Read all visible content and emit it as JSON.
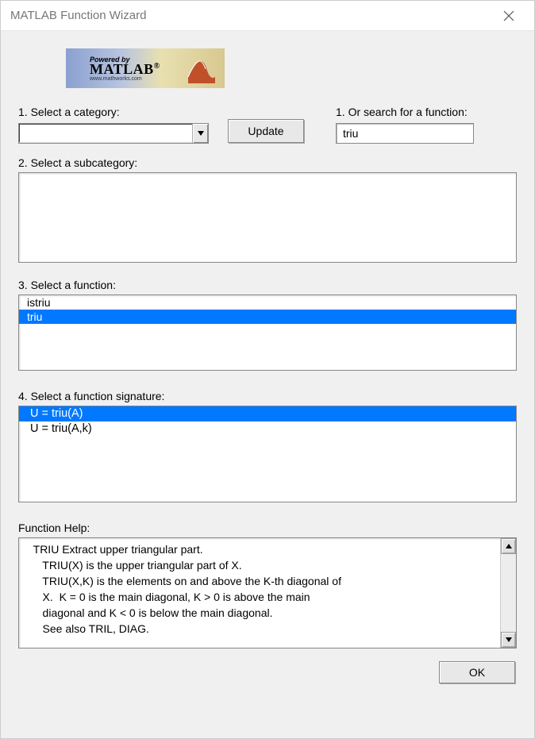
{
  "window": {
    "title": "MATLAB Function Wizard"
  },
  "logo": {
    "powered": "Powered by",
    "brand": "MATLAB",
    "url": "www.mathworks.com"
  },
  "labels": {
    "category": "1. Select a category:",
    "search": "1. Or search for a function:",
    "update": "Update",
    "subcategory": "2. Select a subcategory:",
    "function": "3. Select a function:",
    "signature": "4. Select a function signature:",
    "help": "Function Help:",
    "ok": "OK"
  },
  "category": {
    "value": ""
  },
  "search": {
    "value": "triu"
  },
  "functions": [
    {
      "name": "istriu",
      "selected": false
    },
    {
      "name": "triu",
      "selected": true
    }
  ],
  "signatures": [
    {
      "text": "U = triu(A)",
      "selected": true
    },
    {
      "text": "U = triu(A,k)",
      "selected": false
    }
  ],
  "help": {
    "lines": [
      " TRIU Extract upper triangular part.",
      "    TRIU(X) is the upper triangular part of X.",
      "    TRIU(X,K) is the elements on and above the K-th diagonal of",
      "    X.  K = 0 is the main diagonal, K > 0 is above the main",
      "    diagonal and K < 0 is below the main diagonal.",
      "",
      "    See also TRIL, DIAG."
    ]
  }
}
